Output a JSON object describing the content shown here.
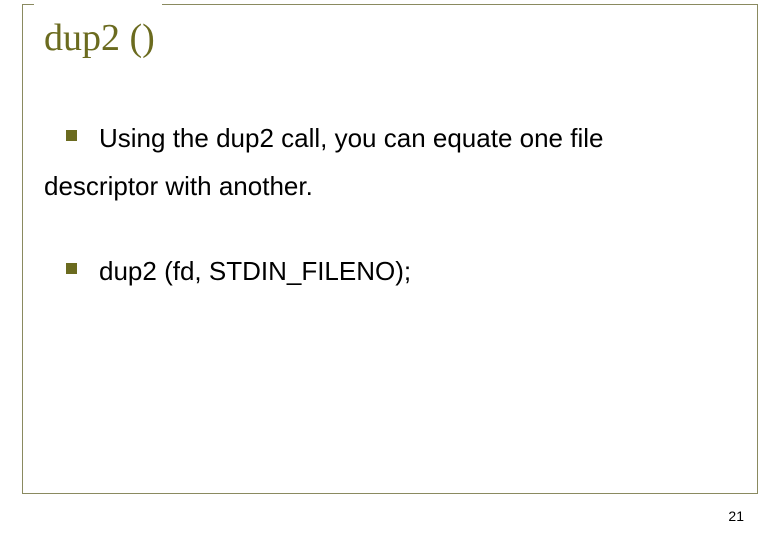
{
  "slide": {
    "title": "dup2 ()",
    "bullets": [
      {
        "first_line": "Using the dup2 call, you can equate one file",
        "continuation": "descriptor with another."
      },
      {
        "first_line": "dup2 (fd, STDIN_FILENO);",
        "continuation": ""
      }
    ],
    "page_number": "21"
  },
  "colors": {
    "accent": "#6b6b1f",
    "frame": "#8a8a60"
  }
}
